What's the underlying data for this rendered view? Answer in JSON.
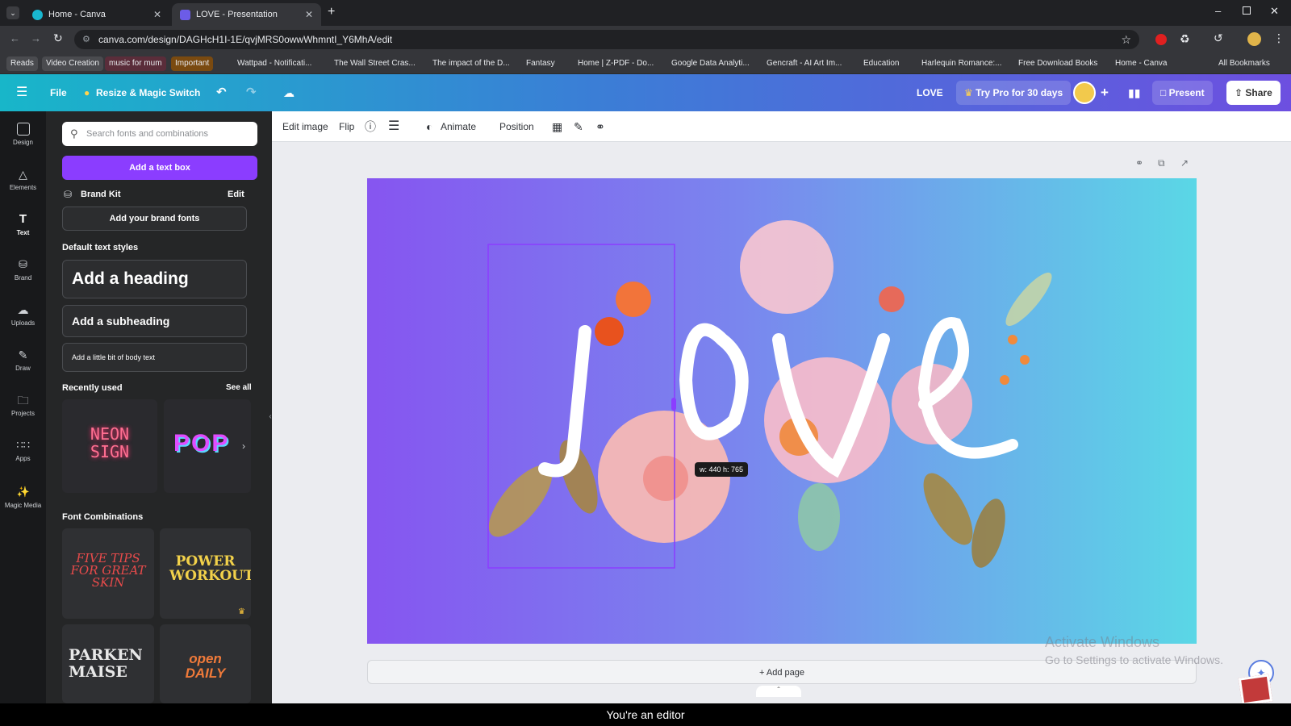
{
  "browser": {
    "tabs": [
      {
        "title": "Home - Canva",
        "active": false
      },
      {
        "title": "LOVE - Presentation",
        "active": true
      }
    ],
    "url": "canva.com/design/DAGHcH1I-1E/qvjMRS0owwWhmntI_Y6MhA/edit",
    "bookmarks": [
      "Reads",
      "Video Creation",
      "music for mum",
      "Important",
      "Wattpad - Notificati...",
      "The Wall Street Cras...",
      "The impact of the D...",
      "Fantasy",
      "Home | Z-PDF - Do...",
      "Google Data Analyti...",
      "Gencraft - AI Art Im...",
      "Education",
      "Harlequin Romance:...",
      "Free Download Books",
      "Home - Canva",
      "All Bookmarks"
    ]
  },
  "header": {
    "file": "File",
    "resize": "Resize & Magic Switch",
    "title": "LOVE",
    "try_pro": "Try Pro for 30 days",
    "present": "Present",
    "share": "Share"
  },
  "rail": [
    "Design",
    "Elements",
    "Text",
    "Brand",
    "Uploads",
    "Draw",
    "Projects",
    "Apps",
    "Magic Media"
  ],
  "panel": {
    "search_placeholder": "Search fonts and combinations",
    "add_text_box": "Add a text box",
    "brand_kit": "Brand Kit",
    "edit": "Edit",
    "add_brand_fonts": "Add your brand fonts",
    "default_styles": "Default text styles",
    "heading": "Add a heading",
    "subheading": "Add a subheading",
    "body": "Add a little bit of body text",
    "recently_used": "Recently used",
    "see_all": "See all",
    "recent_thumbs": [
      "NEON SIGN",
      "POP"
    ],
    "font_combinations": "Font Combinations",
    "combos": [
      "FIVE TIPS FOR GREAT SKIN",
      "POWER WORKOUT",
      "PARKEN MAISE",
      "open DAILY"
    ]
  },
  "toolbar": {
    "edit_image": "Edit image",
    "flip": "Flip",
    "animate": "Animate",
    "position": "Position"
  },
  "canvas": {
    "size_tooltip": "w: 440 h: 765",
    "add_page": "+ Add page"
  },
  "watermark": {
    "line1": "Activate Windows",
    "line2": "Go to Settings to activate Windows."
  },
  "caption": "You're an editor"
}
